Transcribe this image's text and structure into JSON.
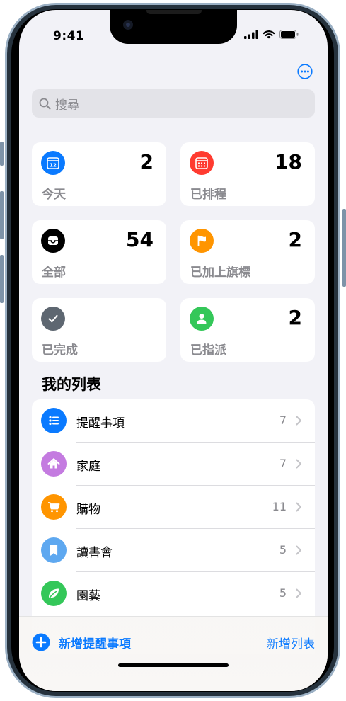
{
  "status_bar": {
    "time": "9:41"
  },
  "search": {
    "placeholder": "搜尋"
  },
  "smart_lists": [
    {
      "label": "今天",
      "count": "2",
      "color": "#0a7aff",
      "icon": "calendar-today-icon",
      "icon_text": "12"
    },
    {
      "label": "已排程",
      "count": "18",
      "color": "#ff3b30",
      "icon": "calendar-icon"
    },
    {
      "label": "全部",
      "count": "54",
      "color": "#000000",
      "icon": "tray-icon"
    },
    {
      "label": "已加上旗標",
      "count": "2",
      "color": "#ff9500",
      "icon": "flag-icon"
    },
    {
      "label": "已完成",
      "count": "",
      "color": "#5e6771",
      "icon": "checkmark-icon"
    },
    {
      "label": "已指派",
      "count": "2",
      "color": "#34c759",
      "icon": "person-icon"
    }
  ],
  "my_lists": {
    "title": "我的列表",
    "items": [
      {
        "name": "提醒事項",
        "count": "7",
        "color": "#0a7aff",
        "icon": "list-bullet-icon"
      },
      {
        "name": "家庭",
        "count": "7",
        "color": "#c47be0",
        "icon": "house-icon"
      },
      {
        "name": "購物",
        "count": "11",
        "color": "#ff9500",
        "icon": "cart-icon"
      },
      {
        "name": "讀書會",
        "count": "5",
        "color": "#5ea8f0",
        "icon": "bookmark-icon"
      },
      {
        "name": "園藝",
        "count": "5",
        "color": "#34c759",
        "icon": "leaf-icon"
      }
    ]
  },
  "toolbar": {
    "add_reminder": "新增提醒事項",
    "add_list": "新增列表"
  }
}
